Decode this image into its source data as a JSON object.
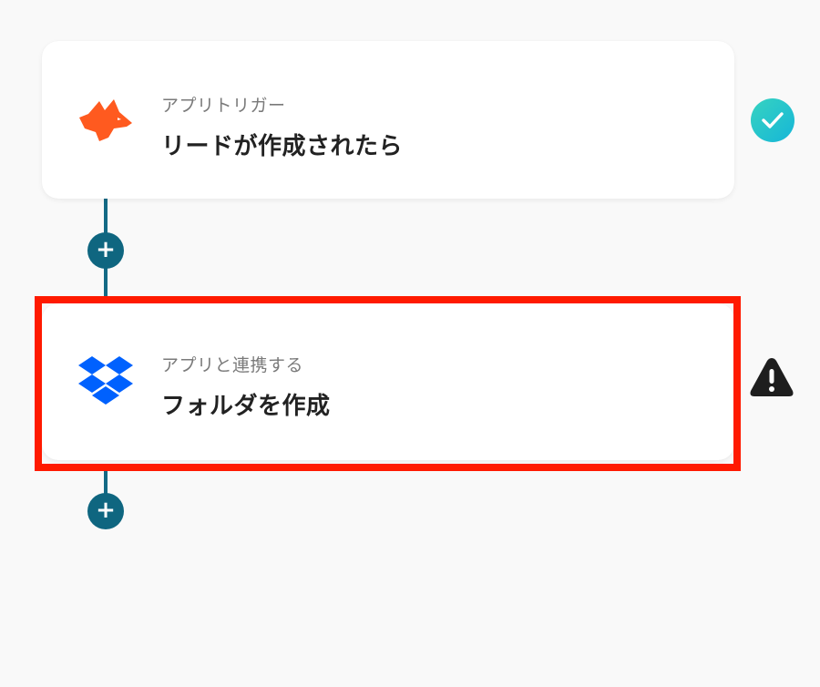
{
  "flow": {
    "steps": [
      {
        "subtitle": "アプリトリガー",
        "title": "リードが作成されたら",
        "app_icon": "fox-icon",
        "status": "complete",
        "status_icon": "check-icon",
        "status_color": "#1fc3cd"
      },
      {
        "subtitle": "アプリと連携する",
        "title": "フォルダを作成",
        "app_icon": "dropbox-icon",
        "status": "warning",
        "status_icon": "warning-icon",
        "status_color": "#1e1e1e",
        "highlighted": true
      }
    ],
    "add_step_label": "+"
  },
  "colors": {
    "accent": "#0f6680",
    "highlight": "#ff1a00",
    "fox": "#ff5a1f",
    "dropbox": "#0061fe"
  }
}
